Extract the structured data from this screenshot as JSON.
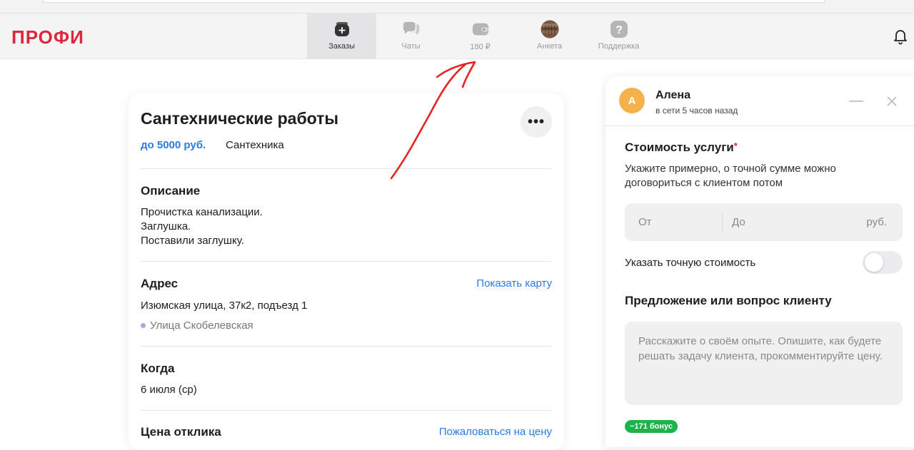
{
  "app": {
    "logo": "ПРОФИ"
  },
  "nav": {
    "items": [
      {
        "label": "Заказы",
        "icon": "orders-icon",
        "active": true
      },
      {
        "label": "Чаты",
        "icon": "chats-icon",
        "active": false
      },
      {
        "label": "180 ₽",
        "icon": "wallet-icon",
        "active": false
      },
      {
        "label": "Анкета",
        "icon": "profile-avatar",
        "active": false
      },
      {
        "label": "Поддержка",
        "icon": "help-icon",
        "active": false
      }
    ]
  },
  "order": {
    "title": "Сантехнические работы",
    "price": "до 5000 руб.",
    "category": "Сантехника",
    "description_title": "Описание",
    "description_lines": [
      "Прочистка канализации.",
      "Заглушка.",
      "Поставили заглушку."
    ],
    "address_title": "Адрес",
    "show_map": "Показать карту",
    "address": "Изюмская улица, 37к2, подъезд 1",
    "metro": "Улица Скобелевская",
    "when_title": "Когда",
    "when": "6 июля (ср)",
    "response_price_title": "Цена отклика",
    "complain_price": "Пожаловаться на цену"
  },
  "response": {
    "client_initial": "А",
    "client_name": "Алена",
    "client_status": "в сети 5 часов назад",
    "cost_title": "Стоимость услуги",
    "required_mark": "*",
    "cost_hint": "Укажите примерно, о точной сумме можно договориться с клиентом потом",
    "from_placeholder": "От",
    "to_placeholder": "До",
    "currency": "руб.",
    "exact_cost_label": "Указать точную стоимость",
    "exact_cost_enabled": false,
    "message_title": "Предложение или вопрос клиенту",
    "message_placeholder": "Расскажите о своём опыте. Опишите, как будете решать задачу клиента, прокомментируйте цену.",
    "bonus_badge": "−171 бонус"
  },
  "colors": {
    "brand": "#e0263f",
    "link": "#2a7ae2",
    "bonus": "#1bb34a",
    "annotation": "#e8231f"
  }
}
